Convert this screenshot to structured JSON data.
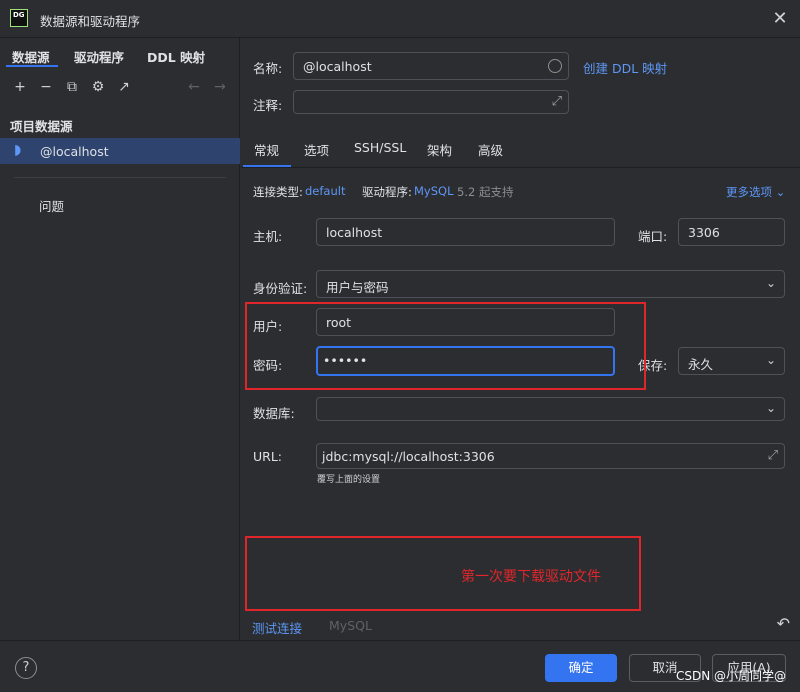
{
  "window": {
    "logo_text": "DG",
    "title": "数据源和驱动程序",
    "close_glyph": "✕"
  },
  "left": {
    "tabs": [
      "数据源",
      "驱动程序",
      "DDL 映射"
    ],
    "toolbar_icons": [
      "plus-icon",
      "minus-icon",
      "copy-icon",
      "gear-icon",
      "export-icon",
      "back-arrow-icon",
      "forward-arrow-icon"
    ],
    "section_label": "项目数据源",
    "selected_item": "@localhost",
    "issues_label": "问题"
  },
  "form": {
    "name_label": "名称:",
    "name_value": "@localhost",
    "create_ddl_link": "创建 DDL 映射",
    "comment_label": "注释:",
    "tabs": [
      "常规",
      "选项",
      "SSH/SSL",
      "架构",
      "高级"
    ],
    "conn_type_label": "连接类型:",
    "conn_type_value": "default",
    "driver_label": "驱动程序:",
    "driver_value": "MySQL",
    "driver_support": "5.2 起支持",
    "more_options": "更多选项",
    "host_label": "主机:",
    "host_value": "localhost",
    "port_label": "端口:",
    "port_value": "3306",
    "auth_label": "身份验证:",
    "auth_value": "用户与密码",
    "user_label": "用户:",
    "user_value": "root",
    "password_label": "密码:",
    "password_value": "••••••",
    "save_label": "保存:",
    "save_value": "永久",
    "database_label": "数据库:",
    "url_label": "URL:",
    "url_value": "jdbc:mysql://localhost:3306",
    "url_hint": "覆写上面的设置"
  },
  "annotation": {
    "note": "第一次要下载驱动文件",
    "color": "#e0262b"
  },
  "bottom": {
    "test_connection": "测试连接",
    "driver_name": "MySQL"
  },
  "footer": {
    "help": "?",
    "ok": "确定",
    "cancel": "取消",
    "apply": "应用(A)",
    "watermark": "CSDN @小周同学@"
  },
  "colors": {
    "accent": "#3574f0",
    "link": "#5e97f6",
    "background": "#2b2d30",
    "selection": "#2e436e"
  }
}
